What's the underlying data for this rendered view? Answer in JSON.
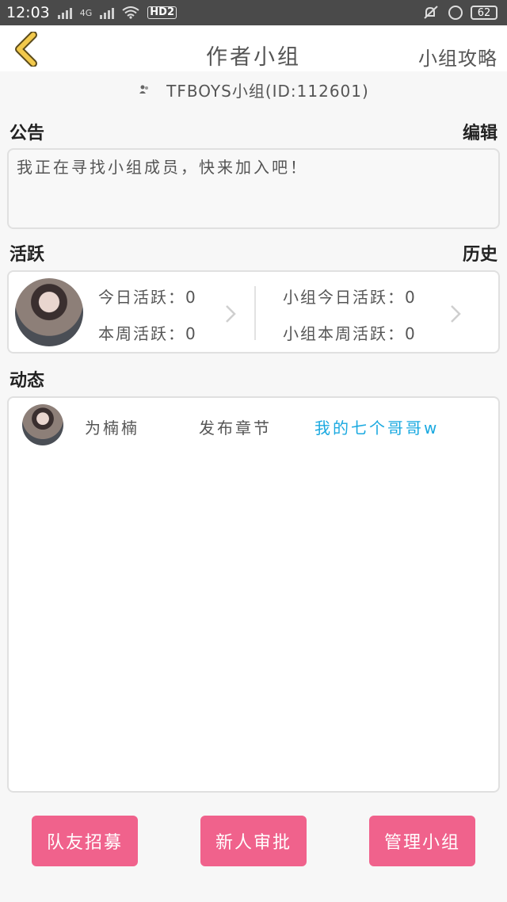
{
  "status_bar": {
    "time": "12:03",
    "network": "4G",
    "hd": "HD2",
    "battery": "62"
  },
  "header": {
    "title": "作者小组",
    "guide_label": "小组攻略"
  },
  "group": {
    "name_id": "TFBOYS小组(ID:112601)"
  },
  "notice": {
    "title": "公告",
    "edit_label": "编辑",
    "content": "我正在寻找小组成员，快来加入吧！"
  },
  "activity": {
    "title": "活跃",
    "history_label": "历史",
    "today_personal": "今日活跃：0",
    "week_personal": "本周活跃：0",
    "today_group": "小组今日活跃：0",
    "week_group": "小组本周活跃：0"
  },
  "feed": {
    "title": "动态",
    "items": [
      {
        "user": "为楠楠",
        "action": "发布章节",
        "target": "我的七个哥哥w"
      }
    ]
  },
  "buttons": {
    "recruit": "队友招募",
    "approve": "新人审批",
    "manage": "管理小组"
  },
  "colors": {
    "accent_pink": "#f0628c",
    "link_blue": "#1aa9e0",
    "back_yellow": "#f2c94c"
  }
}
